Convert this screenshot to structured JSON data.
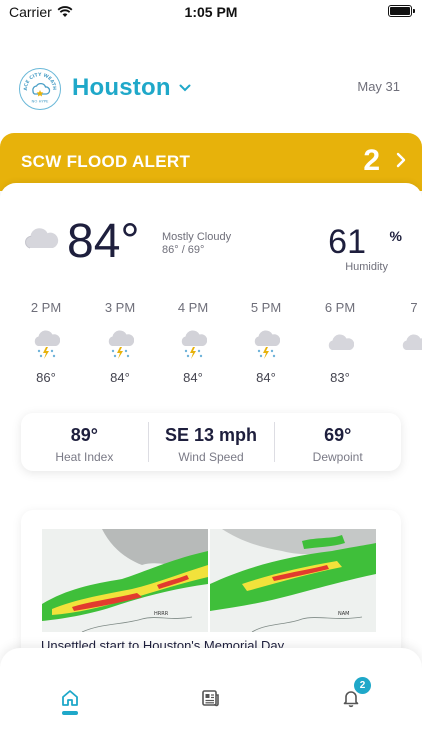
{
  "status_bar": {
    "carrier": "Carrier",
    "time": "1:05 PM"
  },
  "header": {
    "logo_lines": [
      "SPACE CITY WEATHER",
      "NO HYPE"
    ],
    "city": "Houston",
    "date": "May 31"
  },
  "alert": {
    "title": "SCW FLOOD ALERT",
    "count": "2"
  },
  "current": {
    "icon": "cloud-icon",
    "temperature": "84°",
    "condition": "Mostly Cloudy",
    "high_low": "86° / 69°",
    "humidity_value": "61",
    "humidity_unit": "%",
    "humidity_label": "Humidity"
  },
  "hourly": [
    {
      "time": "2 PM",
      "icon": "thunderstorm-icon",
      "temp": "86°"
    },
    {
      "time": "3 PM",
      "icon": "thunderstorm-icon",
      "temp": "84°"
    },
    {
      "time": "4 PM",
      "icon": "thunderstorm-icon",
      "temp": "84°"
    },
    {
      "time": "5 PM",
      "icon": "thunderstorm-icon",
      "temp": "84°"
    },
    {
      "time": "6 PM",
      "icon": "cloud-icon",
      "temp": "83°"
    },
    {
      "time": "7",
      "icon": "cloud-icon",
      "temp": ""
    }
  ],
  "stats": [
    {
      "value": "89°",
      "label": "Heat Index"
    },
    {
      "value": "SE 13 mph",
      "label": "Wind Speed"
    },
    {
      "value": "69°",
      "label": "Dewpoint"
    }
  ],
  "news": {
    "image_labels": [
      "HRRR",
      "NAM"
    ],
    "title": "Unsettled start to Houston's Memorial Day"
  },
  "tabbar": {
    "items": [
      "home-icon",
      "news-icon",
      "bell-icon"
    ],
    "alerts_badge": "2"
  },
  "colors": {
    "accent": "#1fa8c9",
    "alert": "#e7b20b",
    "temp_text": "#1e1f3d"
  }
}
